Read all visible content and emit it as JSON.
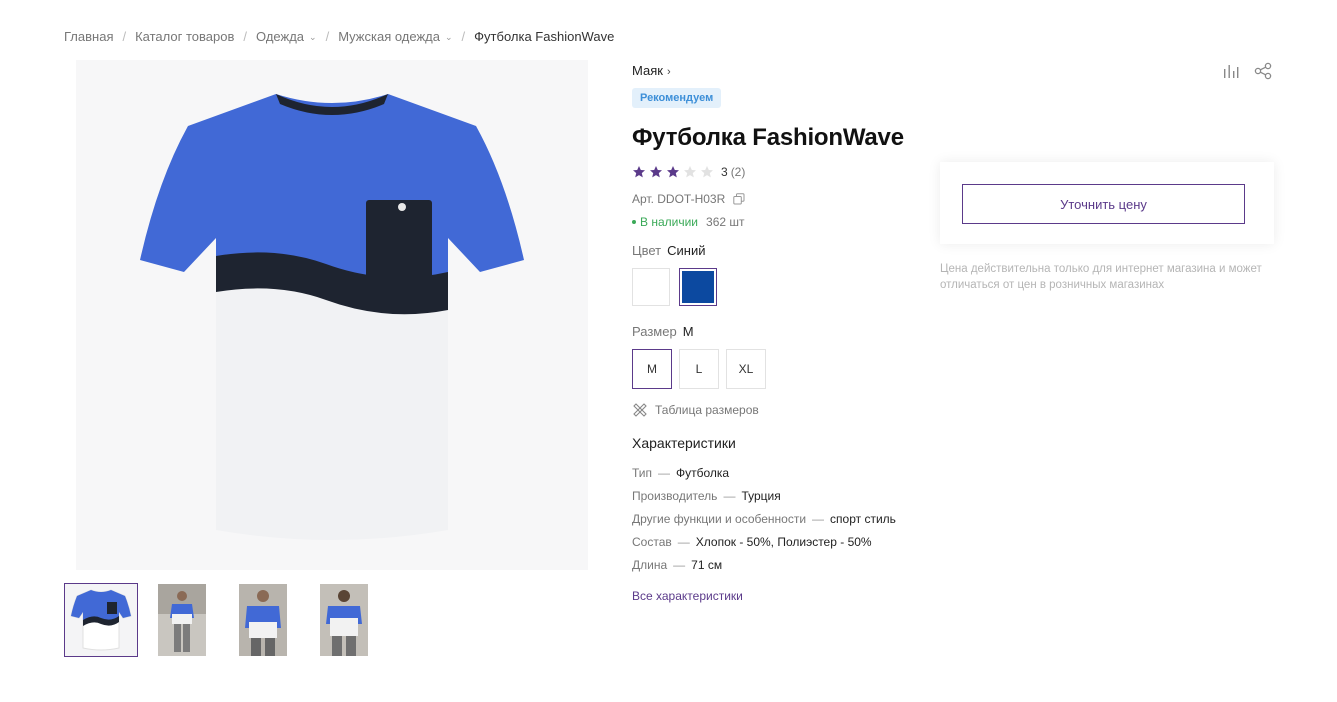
{
  "breadcrumbs": [
    {
      "label": "Главная"
    },
    {
      "label": "Каталог товаров"
    },
    {
      "label": "Одежда"
    },
    {
      "label": "Мужская одежда"
    },
    {
      "label": "Футболка FashionWave"
    }
  ],
  "product": {
    "brand": "Маяк",
    "badge": "Рекомендуем",
    "title": "Футболка FashionWave",
    "rating": {
      "value": "3",
      "count": "(2)",
      "stars_filled": 3,
      "stars_total": 5
    },
    "sku": "Арт. DDOT-H03R",
    "stock": {
      "status": "В наличии",
      "quantity": "362 шт"
    },
    "color": {
      "label": "Цвет",
      "selected": "Синий",
      "options": [
        "#ffffff",
        "#0c49a0"
      ]
    },
    "size": {
      "label": "Размер",
      "selected": "M",
      "options": [
        "M",
        "L",
        "XL"
      ]
    },
    "size_chart": "Таблица размеров",
    "characteristics_title": "Характеристики",
    "characteristics": [
      {
        "key": "Тип",
        "value": "Футболка"
      },
      {
        "key": "Производитель",
        "value": "Турция"
      },
      {
        "key": "Другие функции и особенности",
        "value": "спорт стиль"
      },
      {
        "key": "Состав",
        "value": "Хлопок - 50%, Полиэстер - 50%"
      },
      {
        "key": "Длина",
        "value": "71 см"
      }
    ],
    "all_characteristics": "Все характеристики"
  },
  "price": {
    "button": "Уточнить цену",
    "note": "Цена действительна только для интернет магазина и может отличаться от цен в розничных магазинах"
  },
  "separator": "—",
  "crumb_separator": "/",
  "icons": [
    "compare-icon",
    "share-icon",
    "copy-icon",
    "ruler-icon",
    "star-icon"
  ],
  "colors": {
    "accent": "#5b3a8a",
    "badge_bg": "#e3f0fb",
    "badge_text": "#3d8fd8",
    "in_stock": "#3aa957",
    "tshirt_blue": "#4169d6",
    "tshirt_black": "#1e2430"
  }
}
